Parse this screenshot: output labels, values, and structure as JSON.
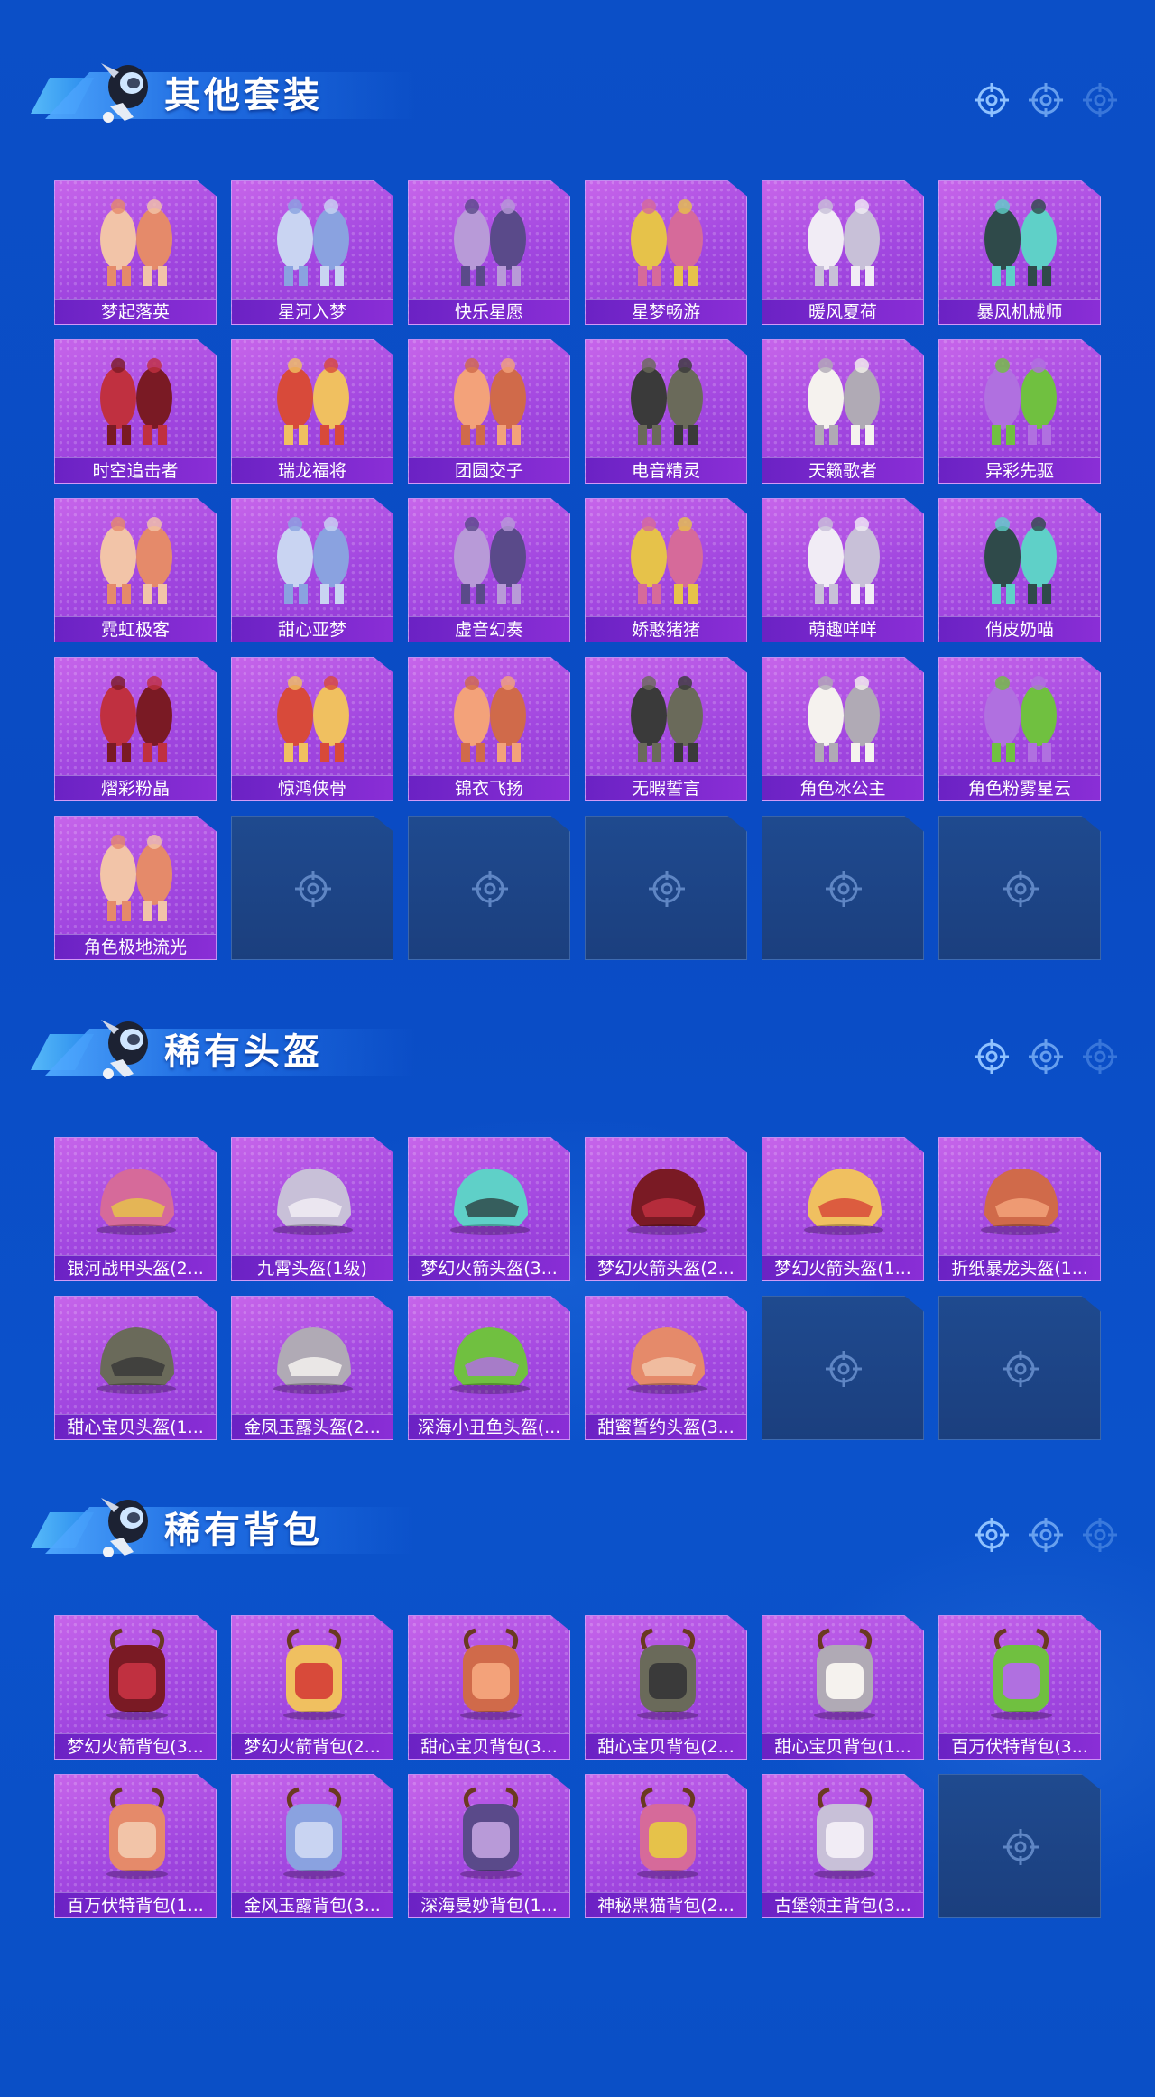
{
  "colors": {
    "background": "#0b4fc7",
    "card": "#a247e0",
    "label_bar": "#6b22c4",
    "empty_slot": "#1f4a8f"
  },
  "sections": [
    {
      "title": "其他套装",
      "items": [
        "梦起落英",
        "星河入梦",
        "快乐星愿",
        "星梦畅游",
        "暖风夏荷",
        "暴风机械师",
        "时空追击者",
        "瑞龙福将",
        "团圆交子",
        "电音精灵",
        "天籁歌者",
        "异彩先驱",
        "霓虹极客",
        "甜心亚梦",
        "虚音幻奏",
        "娇憨猪猪",
        "萌趣咩咩",
        "俏皮奶喵",
        "熠彩粉晶",
        "惊鸿侠骨",
        "锦衣飞扬",
        "无暇誓言",
        "角色冰公主",
        "角色粉雾星云",
        "角色极地流光"
      ],
      "empty_slots": 5
    },
    {
      "title": "稀有头盔",
      "items": [
        "银河战甲头盔(2...",
        "九霄头盔(1级)",
        "梦幻火箭头盔(3...",
        "梦幻火箭头盔(2...",
        "梦幻火箭头盔(1...",
        "折纸暴龙头盔(1...",
        "甜心宝贝头盔(1...",
        "金凤玉露头盔(2...",
        "深海小丑鱼头盔(...",
        "甜蜜誓约头盔(3..."
      ],
      "empty_slots": 2
    },
    {
      "title": "稀有背包",
      "items": [
        "梦幻火箭背包(3...",
        "梦幻火箭背包(2...",
        "甜心宝贝背包(3...",
        "甜心宝贝背包(2...",
        "甜心宝贝背包(1...",
        "百万伏特背包(3...",
        "百万伏特背包(1...",
        "金风玉露背包(3...",
        "深海曼妙背包(1...",
        "神秘黑猫背包(2...",
        "古堡领主背包(3..."
      ],
      "empty_slots": 1
    }
  ]
}
